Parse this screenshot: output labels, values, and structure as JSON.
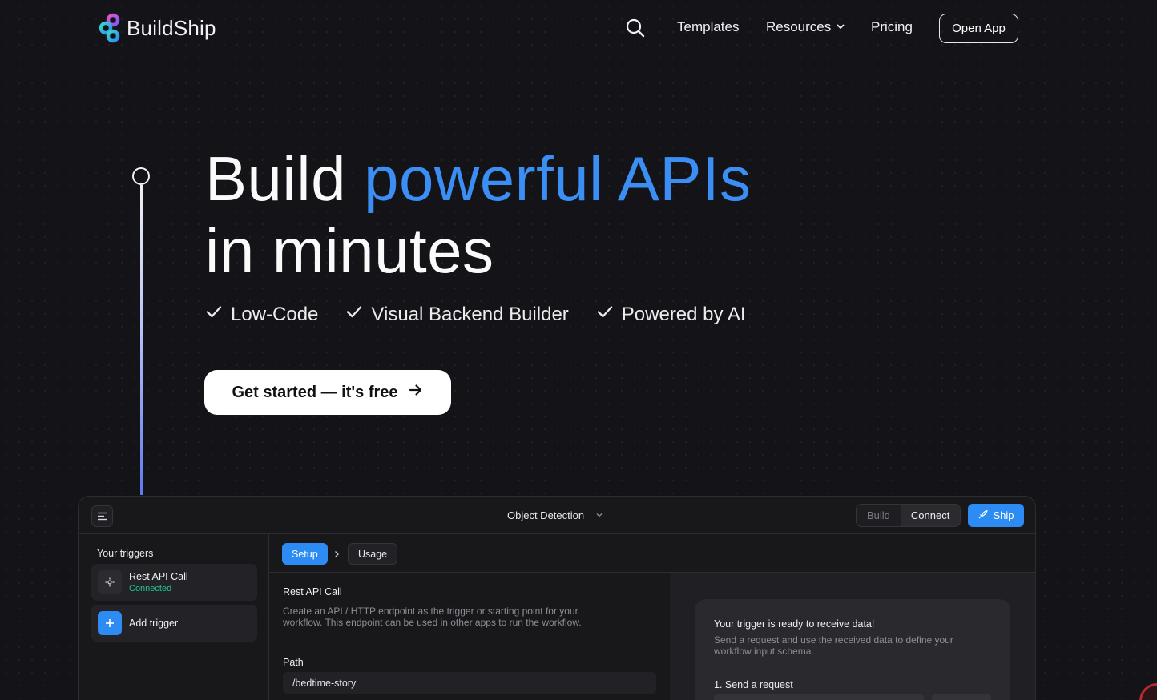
{
  "nav": {
    "brand": "BuildShip",
    "links": [
      "Templates",
      "Resources",
      "Pricing"
    ],
    "open_app": "Open App",
    "icons": {
      "search": "search-icon",
      "resources": "chevron-down-icon"
    }
  },
  "hero": {
    "title_start": "Build",
    "title_accent": "powerful APIs",
    "title_line2": "in minutes",
    "features": [
      "Low-Code",
      "Visual Backend Builder",
      "Powered by AI"
    ],
    "cta": "Get started — it's free",
    "accent_color": "#3a8ef4"
  },
  "app": {
    "workflow_name": "Object Detection",
    "modes": [
      "Build",
      "Connect"
    ],
    "active_mode": "Connect",
    "ship": "Ship",
    "sidebar": {
      "title": "Your triggers",
      "trigger_name": "Rest API Call",
      "trigger_status": "Connected",
      "add": "Add trigger"
    },
    "tabs": [
      "Setup",
      "Usage"
    ],
    "form": {
      "title": "Rest API Call",
      "description": "Create an API / HTTP endpoint as the trigger or starting point for your workflow. This endpoint can be used in other apps to run the workflow.",
      "path_label": "Path",
      "path_value": "/bedtime-story"
    },
    "panel": {
      "title": "Your trigger is ready to receive data!",
      "description": "Send a request and use the received data to define your workflow input schema.",
      "step": "1. Send a request"
    },
    "colors": {
      "primary": "#2c8cf4",
      "connected": "#22c38e"
    }
  }
}
